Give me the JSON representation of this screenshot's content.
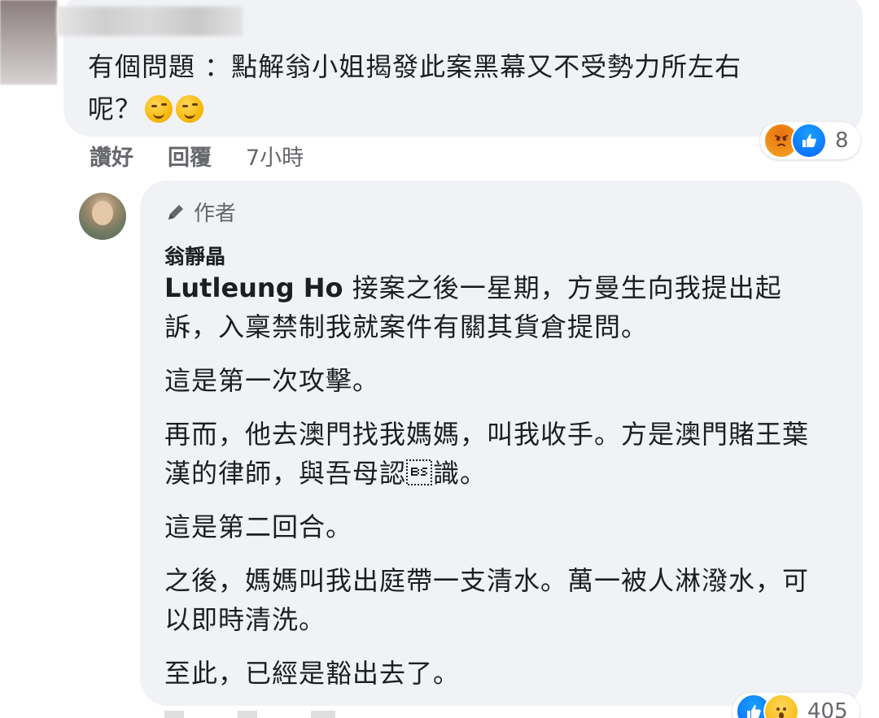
{
  "top_comment": {
    "text_line1": "有個問題 ：點解翁小姐揭發此案黑幕又不受勢力所左右",
    "text_line2": "呢？",
    "emojis": [
      "wink-icon",
      "wink-icon"
    ],
    "reactions": {
      "icons": [
        "angry-icon",
        "like-icon"
      ],
      "count": "8"
    },
    "actions": {
      "like_label": "讚好",
      "reply_label": "回覆",
      "time": "7小時"
    }
  },
  "reply": {
    "badge_label": "作者",
    "author_name": "翁靜晶",
    "mention": "Lutleung Ho",
    "paragraphs": [
      " 接案之後一星期，方曼生向我提出起訴，入稟禁制我就案件有關其貨倉提問。",
      "這是第一次攻擊。",
      "再而，他去澳門找我媽媽，叫我收手。方是澳門賭王葉漢的律師，與吾母認\b識。",
      "這是第二回合。",
      "之後，媽媽叫我出庭帶一支清水。萬一被人淋潑水，可以即時清洗。",
      "至此，已經是豁出去了。"
    ],
    "reactions": {
      "icons": [
        "like-icon",
        "wow-icon"
      ],
      "count": "405"
    }
  }
}
